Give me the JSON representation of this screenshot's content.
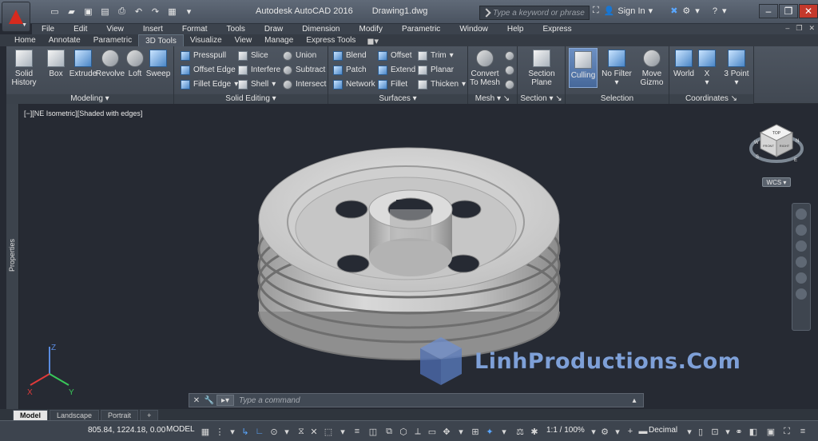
{
  "app": {
    "title": "Autodesk AutoCAD 2016",
    "document": "Drawing1.dwg",
    "search_placeholder": "Type a keyword or phrase",
    "sign_in": "Sign In",
    "brand_color": "#d62a1e"
  },
  "menu": [
    "File",
    "Edit",
    "View",
    "Insert",
    "Format",
    "Tools",
    "Draw",
    "Dimension",
    "Modify",
    "Parametric",
    "Window",
    "Help",
    "Express"
  ],
  "ribbon_tabs": [
    "Home",
    "Annotate",
    "Parametric",
    "3D Tools",
    "Visualize",
    "View",
    "Manage",
    "Express Tools"
  ],
  "active_tab": "3D Tools",
  "panels": {
    "modeling": {
      "title": "Modeling",
      "solid_history": "Solid History",
      "box": "Box",
      "extrude": "Extrude",
      "revolve": "Revolve",
      "loft": "Loft",
      "sweep": "Sweep"
    },
    "solid_editing": {
      "title": "Solid Editing",
      "presspull": "Presspull",
      "offset_edge": "Offset Edge",
      "fillet_edge": "Fillet Edge",
      "slice": "Slice",
      "interfere": "Interfere",
      "shell": "Shell",
      "union": "Union",
      "subtract": "Subtract",
      "intersect": "Intersect"
    },
    "surfaces": {
      "title": "Surfaces",
      "blend": "Blend",
      "patch": "Patch",
      "network": "Network",
      "offset": "Offset",
      "extend": "Extend",
      "fillet": "Fillet",
      "trim": "Trim",
      "planar": "Planar",
      "thicken": "Thicken"
    },
    "mesh": {
      "title": "Mesh",
      "convert": "Convert To Mesh"
    },
    "section": {
      "title": "Section",
      "plane": "Section Plane"
    },
    "selection": {
      "title": "Selection",
      "culling": "Culling",
      "no_filter": "No Filter",
      "move_gizmo": "Move Gizmo"
    },
    "coordinates": {
      "title": "Coordinates",
      "world": "World",
      "x": "X",
      "three_point": "3 Point"
    }
  },
  "viewport": {
    "label": "[−][NE Isometric][Shaded with edges]",
    "properties": "Properties",
    "wcs": "WCS",
    "viewcube": {
      "top": "TOP",
      "front": "FRONT",
      "right": "RIGHT",
      "north": "N",
      "east": "E",
      "south": "S",
      "west": "W"
    },
    "ucs": {
      "x": "X",
      "y": "Y",
      "z": "Z"
    }
  },
  "watermark": "LinhProductions.Com",
  "command": {
    "placeholder": "Type a command"
  },
  "layout_tabs": [
    "Model",
    "Landscape",
    "Portrait"
  ],
  "status": {
    "coords": "805.84, 1224.18, 0.00",
    "model": "MODEL",
    "scale": "1:1 / 100%",
    "units": "Decimal"
  }
}
